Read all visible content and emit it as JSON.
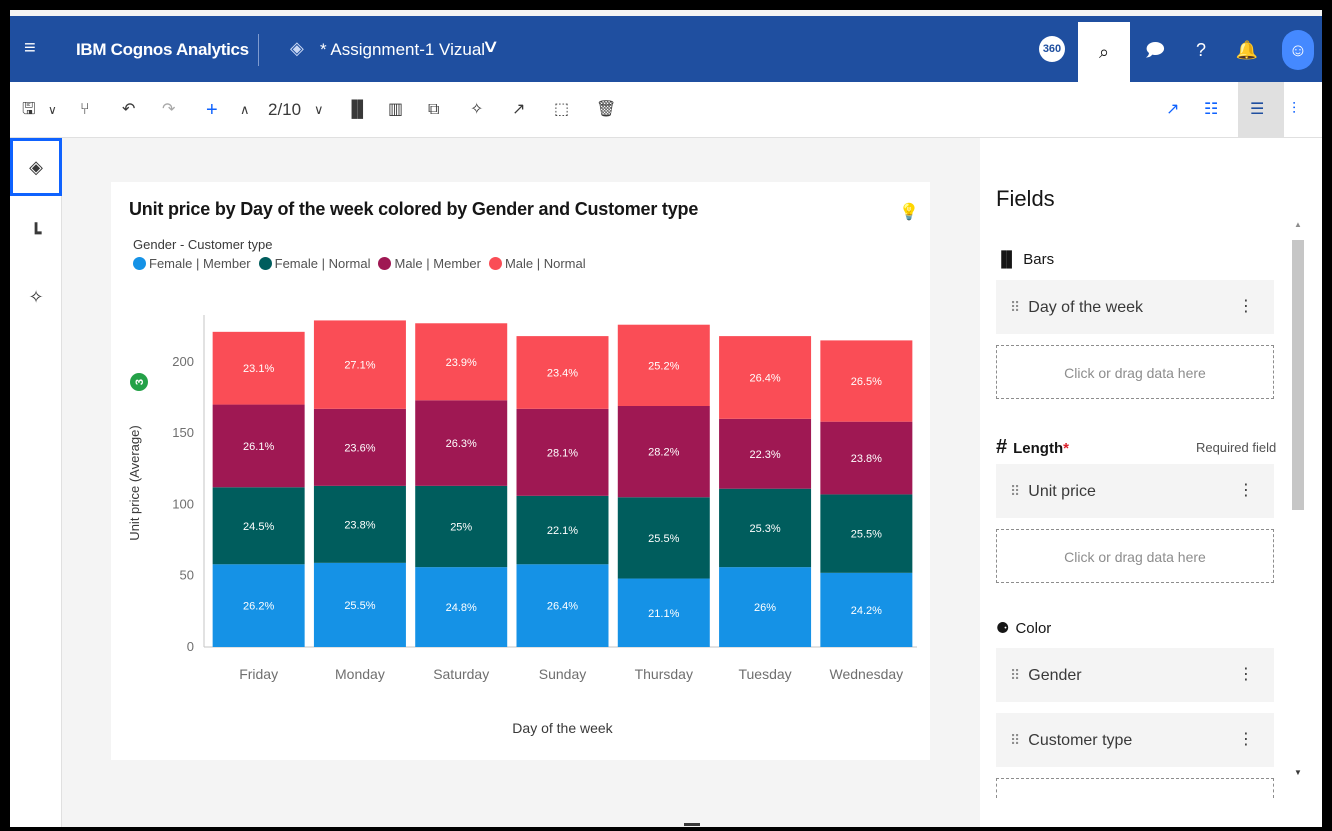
{
  "app": {
    "brand": "IBM Cognos Analytics",
    "doc_title": "* Assignment-1 Vizual",
    "badge_360": "360"
  },
  "toolbar": {
    "pager": "2/10"
  },
  "chart_data": {
    "type": "bar",
    "stacked": true,
    "title": "Unit price by Day of the week colored by Gender and Customer type",
    "legend_title": "Gender - Customer type",
    "xlabel": "Day of the week",
    "ylabel": "Unit price (Average)",
    "ylim": [
      0,
      230
    ],
    "yticks": [
      0,
      50,
      100,
      150,
      200
    ],
    "badge": "3",
    "categories": [
      "Friday",
      "Monday",
      "Saturday",
      "Sunday",
      "Thursday",
      "Tuesday",
      "Wednesday"
    ],
    "series": [
      {
        "name": "Female | Member",
        "color": "#1592e6",
        "values": [
          58,
          59,
          56,
          58,
          48,
          56,
          52
        ],
        "labels": [
          "26.2%",
          "25.5%",
          "24.8%",
          "26.4%",
          "21.1%",
          "26%",
          "24.2%"
        ]
      },
      {
        "name": "Female | Normal",
        "color": "#005d5d",
        "values": [
          54,
          54,
          57,
          48,
          57,
          55,
          55
        ],
        "labels": [
          "24.5%",
          "23.8%",
          "25%",
          "22.1%",
          "25.5%",
          "25.3%",
          "25.5%"
        ]
      },
      {
        "name": "Male | Member",
        "color": "#9f1853",
        "values": [
          58,
          54,
          60,
          61,
          64,
          49,
          51
        ],
        "labels": [
          "26.1%",
          "23.6%",
          "26.3%",
          "28.1%",
          "28.2%",
          "22.3%",
          "23.8%"
        ]
      },
      {
        "name": "Male | Normal",
        "color": "#fa4d56",
        "values": [
          51,
          62,
          54,
          51,
          57,
          58,
          57
        ],
        "labels": [
          "23.1%",
          "27.1%",
          "23.9%",
          "23.4%",
          "25.2%",
          "26.4%",
          "26.5%"
        ]
      }
    ]
  },
  "fields": {
    "title": "Fields",
    "bars": {
      "label": "Bars",
      "items": [
        "Day of the week"
      ],
      "drop": "Click or drag data here"
    },
    "length": {
      "label": "Length",
      "asterisk": "*",
      "required": "Required field",
      "items": [
        "Unit price"
      ],
      "drop": "Click or drag data here"
    },
    "color": {
      "label": "Color",
      "items": [
        "Gender",
        "Customer type"
      ]
    }
  }
}
